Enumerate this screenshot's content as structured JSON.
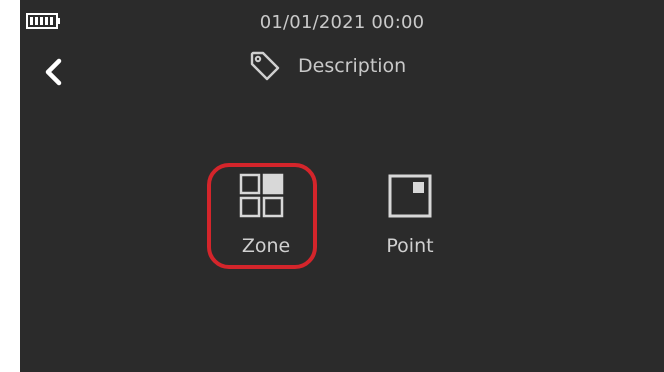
{
  "status_bar": {
    "battery_icon": "battery-full-icon",
    "datetime": "01/01/2021  00:00"
  },
  "header": {
    "back_icon": "chevron-left-icon",
    "tag_icon": "tag-icon",
    "title": "Description"
  },
  "modes": {
    "selected": "Zone",
    "highlight_color": "#d4252b",
    "items": [
      {
        "label": "Zone",
        "icon": "zone-grid-icon"
      },
      {
        "label": "Point",
        "icon": "point-square-icon"
      }
    ]
  },
  "colors": {
    "background": "#2b2b2b",
    "text": "#d6d6d6"
  }
}
